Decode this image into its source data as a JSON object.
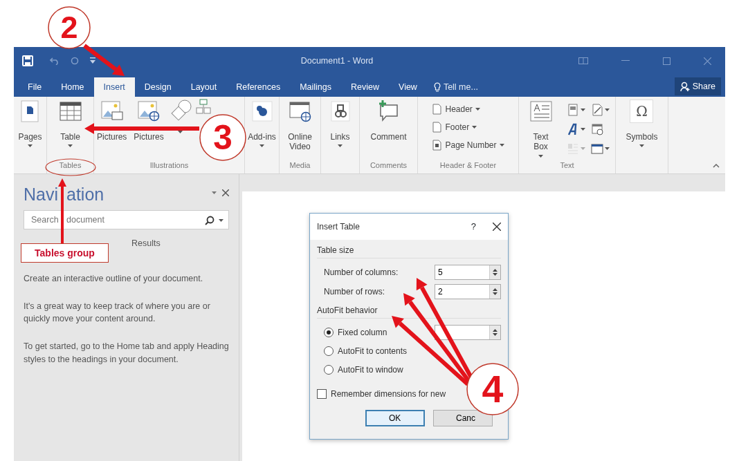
{
  "annotations": {
    "steps": [
      {
        "label": "2"
      },
      {
        "label": "3"
      },
      {
        "label": "4"
      }
    ],
    "callout": "Tables group"
  },
  "window": {
    "title": "Document1 - Word"
  },
  "tabs": [
    {
      "label": "File",
      "selected": false
    },
    {
      "label": "Home",
      "selected": false
    },
    {
      "label": "Insert",
      "selected": true
    },
    {
      "label": "Design",
      "selected": false
    },
    {
      "label": "Layout",
      "selected": false
    },
    {
      "label": "References",
      "selected": false
    },
    {
      "label": "Mailings",
      "selected": false
    },
    {
      "label": "Review",
      "selected": false
    },
    {
      "label": "View",
      "selected": false
    }
  ],
  "tell_me": "Tell me...",
  "share": "Share",
  "ribbon": {
    "groups": [
      {
        "buttons": [
          {
            "kind": "large",
            "label": "Pages",
            "dropdown": true
          }
        ]
      },
      {
        "label": "Tables",
        "buttons": [
          {
            "kind": "large",
            "label": "Table",
            "dropdown": true
          }
        ]
      },
      {
        "label": "Illustrations",
        "buttons": [
          {
            "kind": "large",
            "label": "Pictures",
            "dropdown": false
          },
          {
            "kind": "large",
            "label": "Pictures",
            "dropdown": false
          },
          {
            "kind": "icon",
            "dropdown": true
          },
          {
            "kind": "icon",
            "dropdown": false
          }
        ]
      },
      {
        "buttons": [
          {
            "kind": "large",
            "label": "Add-ins",
            "dropdown": true
          }
        ]
      },
      {
        "label": "Media",
        "buttons": [
          {
            "kind": "large",
            "label": "Online Video",
            "dropdown": false
          }
        ]
      },
      {
        "buttons": [
          {
            "kind": "large",
            "label": "Links",
            "dropdown": true
          }
        ]
      },
      {
        "label": "Comments",
        "buttons": [
          {
            "kind": "large",
            "label": "Comment",
            "dropdown": false
          }
        ]
      },
      {
        "label": "Header & Footer",
        "buttons": [
          {
            "kind": "small",
            "label": "Header",
            "dropdown": true
          },
          {
            "kind": "small",
            "label": "Footer",
            "dropdown": true
          },
          {
            "kind": "small",
            "label": "Page Number",
            "dropdown": true
          }
        ]
      },
      {
        "label": "Text",
        "buttons": [
          {
            "kind": "large",
            "label": "Text Box",
            "dropdown": true
          },
          {
            "kind": "tool",
            "dropdown": true,
            "disabled": false
          },
          {
            "kind": "tool",
            "dropdown": true,
            "disabled": false
          },
          {
            "kind": "tool",
            "dropdown": true,
            "disabled": true
          },
          {
            "kind": "tool",
            "dropdown": true,
            "disabled": false
          },
          {
            "kind": "tool",
            "dropdown": false,
            "disabled": false
          },
          {
            "kind": "tool",
            "dropdown": true,
            "disabled": false
          }
        ]
      },
      {
        "buttons": [
          {
            "kind": "glyph",
            "glyph": "Ω",
            "label": "Symbols",
            "dropdown": true
          }
        ]
      }
    ]
  },
  "navigation": {
    "title_parts": [
      "Navi",
      "ation"
    ],
    "search": {
      "placeholder": "Search document"
    },
    "tabs": [
      {
        "label": "Results",
        "selected": false
      }
    ],
    "paragraphs": [
      "Create an interactive outline of your document.",
      "It's a great way to keep track of where you are or quickly move your content around.",
      "To get started, go to the Home tab and apply Heading styles to the headings in your document."
    ]
  },
  "dialog": {
    "title": "Insert Table",
    "help": "?",
    "table_size": {
      "heading": "Table size",
      "fields": [
        {
          "label": "Number of columns:",
          "value": "5"
        },
        {
          "label": "Number of rows:",
          "value": "2"
        }
      ]
    },
    "autofit": {
      "heading": "AutoFit behavior",
      "options": [
        {
          "label": "Fixed column",
          "selected": true,
          "field": true
        },
        {
          "label": "AutoFit to contents",
          "selected": false,
          "field": false
        },
        {
          "label": "AutoFit to window",
          "selected": false,
          "field": false
        }
      ]
    },
    "remember": {
      "label": "Remember dimensions for new",
      "checked": false
    },
    "buttons": [
      {
        "label": "OK",
        "default": true
      },
      {
        "label": "Canc",
        "default": false
      }
    ]
  }
}
